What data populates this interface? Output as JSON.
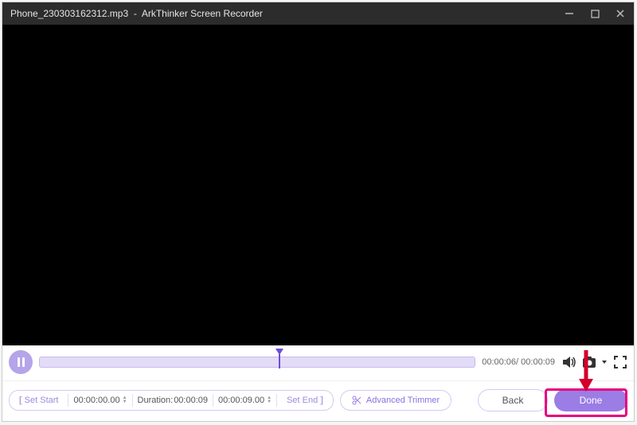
{
  "titlebar": {
    "filename": "Phone_230303162312.mp3",
    "separator": "-",
    "app_name": "ArkThinker Screen Recorder"
  },
  "playback": {
    "current_time": "00:00:06",
    "total_time": "00:00:09"
  },
  "trim": {
    "set_start_label": "Set Start",
    "start_time": "00:00:00.00",
    "duration_label": "Duration:",
    "duration_value": "00:00:09",
    "end_time": "00:00:09.00",
    "set_end_label": "Set End",
    "advanced_label": "Advanced Trimmer"
  },
  "actions": {
    "back_label": "Back",
    "done_label": "Done"
  }
}
